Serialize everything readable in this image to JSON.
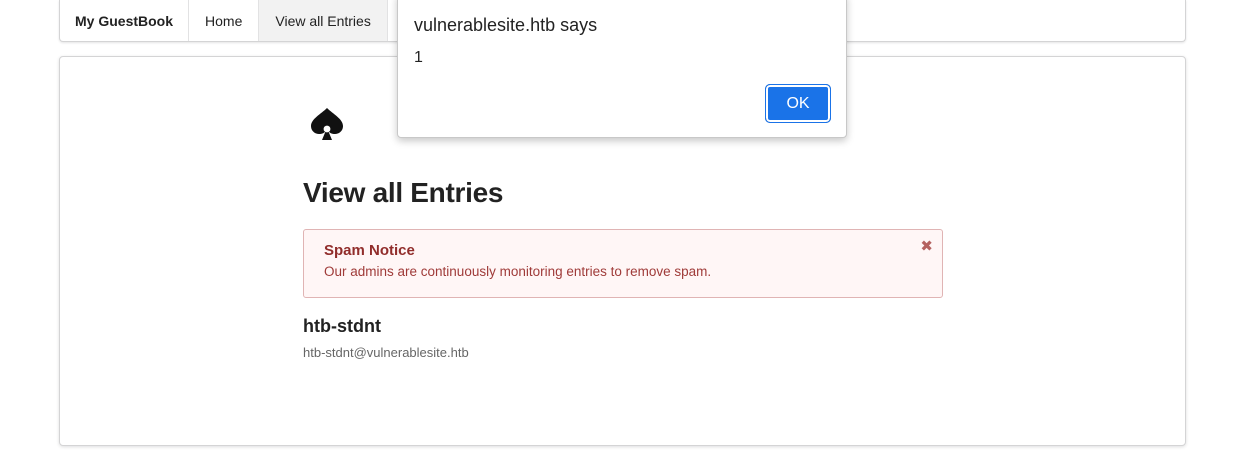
{
  "nav": {
    "brand": "My GuestBook",
    "items": [
      {
        "label": "Home",
        "active": false
      },
      {
        "label": "View all Entries",
        "active": true
      }
    ]
  },
  "page": {
    "title": "View all Entries",
    "icon": "spade-icon"
  },
  "notice": {
    "title": "Spam Notice",
    "text": "Our admins are continuously monitoring entries to remove spam.",
    "close_icon": "close-icon",
    "background": "#fff6f6",
    "border": "#e0b4b4",
    "color": "#9f3a38"
  },
  "entries": [
    {
      "name": "htb-stdnt",
      "email": "htb-stdnt@vulnerablesite.htb"
    }
  ],
  "dialog": {
    "title": "vulnerablesite.htb says",
    "message": "1",
    "ok_label": "OK",
    "accent": "#1a73e8"
  }
}
